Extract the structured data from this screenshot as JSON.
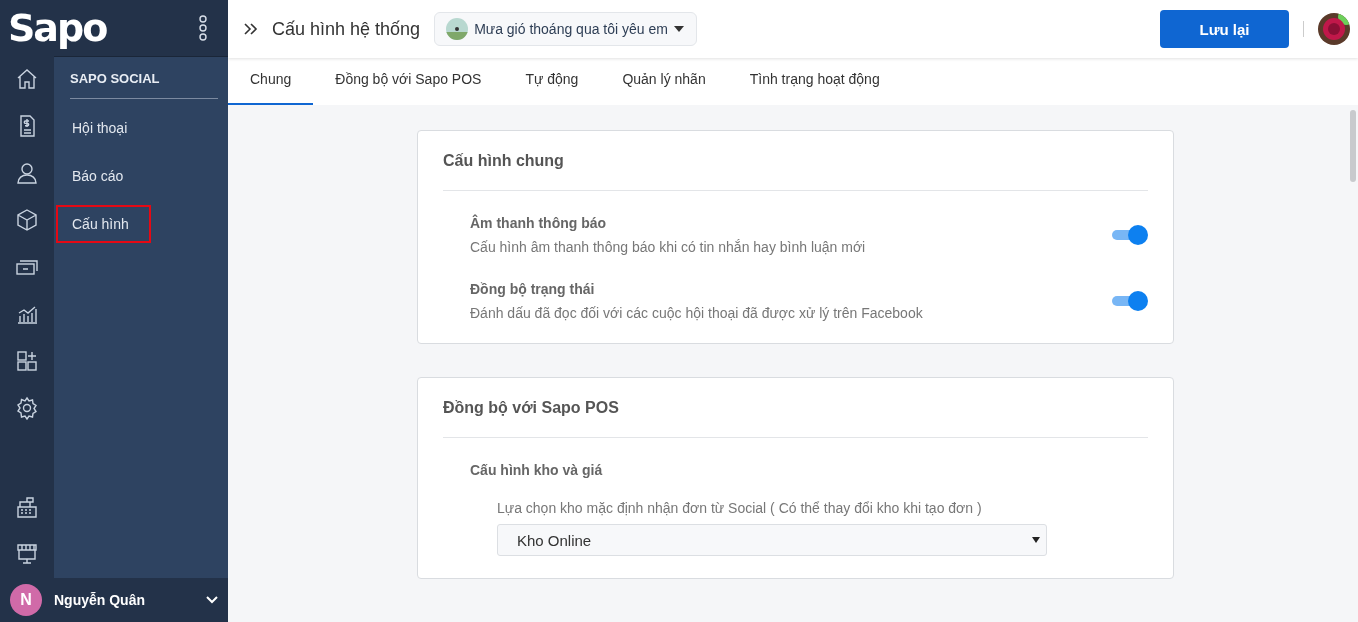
{
  "logo": "Sapo",
  "rail_icons": [
    {
      "kind": "home"
    },
    {
      "kind": "invoice"
    },
    {
      "kind": "user"
    },
    {
      "kind": "box"
    },
    {
      "kind": "money"
    },
    {
      "kind": "chart"
    },
    {
      "kind": "apps"
    },
    {
      "kind": "gear"
    }
  ],
  "rail_bottom_icons": [
    {
      "kind": "register"
    },
    {
      "kind": "store"
    }
  ],
  "sidebar": {
    "heading": "SAPO SOCIAL",
    "items": [
      {
        "label": "Hội thoại",
        "selected": false
      },
      {
        "label": "Báo cáo",
        "selected": false
      },
      {
        "label": "Cấu hình",
        "selected": true
      }
    ]
  },
  "user": {
    "initial": "N",
    "name": "Nguyễn Quân"
  },
  "header": {
    "title": "Cấu hình hệ thống",
    "page_selector": "Mưa gió thoáng qua tôi yêu em",
    "save_button": "Lưu lại"
  },
  "tabs": [
    {
      "label": "Chung",
      "selected": true
    },
    {
      "label": "Đồng bộ với Sapo POS",
      "selected": false
    },
    {
      "label": "Tự động",
      "selected": false
    },
    {
      "label": "Quản lý nhãn",
      "selected": false
    },
    {
      "label": "Tình trạng hoạt động",
      "selected": false
    }
  ],
  "sections": [
    {
      "title": "Cấu hình chung",
      "settings": [
        {
          "kind": "toggle",
          "label": "Âm thanh thông báo",
          "description": "Cấu hình âm thanh thông báo khi có tin nhắn hay bình luận mới",
          "on": true
        },
        {
          "kind": "toggle",
          "label": "Đồng bộ trạng thái",
          "description": "Đánh dấu đã đọc đối với các cuộc hội thoại đã được xử lý trên Facebook",
          "on": true
        }
      ]
    },
    {
      "title": "Đồng bộ với Sapo POS",
      "settings": [
        {
          "kind": "select",
          "label": "Cấu hình kho và giá",
          "description": "Lựa chọn kho mặc định nhận đơn từ Social ( Có thể thay đổi kho khi tạo đơn )",
          "value": "Kho Online"
        }
      ]
    }
  ]
}
